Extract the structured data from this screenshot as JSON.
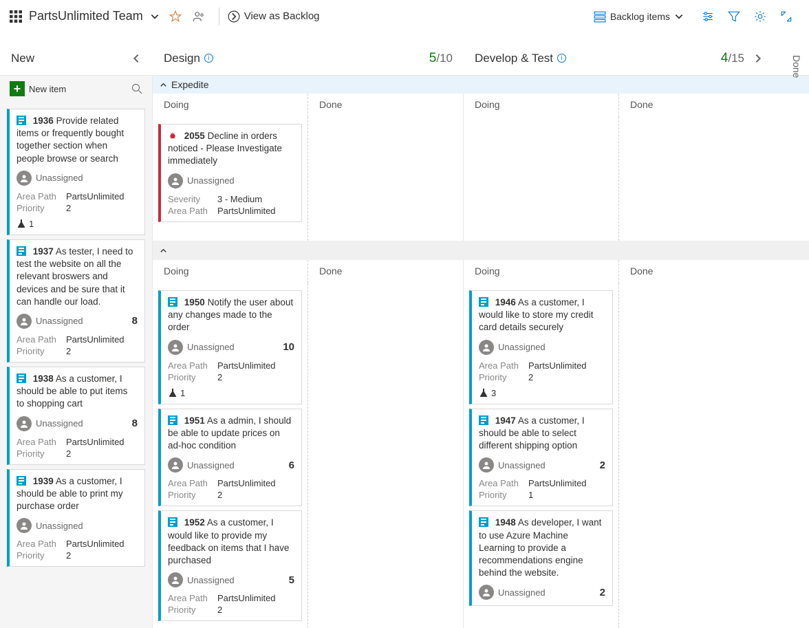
{
  "header": {
    "teamName": "PartsUnlimited Team",
    "viewBacklog": "View as Backlog",
    "backlogItems": "Backlog items"
  },
  "columns": {
    "new": "New",
    "design": "Design",
    "designWip": {
      "cur": "5",
      "lim": "/10"
    },
    "dev": "Develop & Test",
    "devWip": {
      "cur": "4",
      "lim": "/15"
    },
    "done": "Done"
  },
  "newItem": "New item",
  "expedite": "Expedite",
  "subcols": {
    "doing": "Doing",
    "done": "Done"
  },
  "labels": {
    "areaPath": "Area Path",
    "priority": "Priority",
    "severity": "Severity",
    "unassigned": "Unassigned"
  },
  "bug": {
    "id": "2055",
    "title": "Decline in orders noticed - Please Investigate immediately",
    "severity": "3 - Medium",
    "areaPath": "PartsUnlimited"
  },
  "newCol": [
    {
      "id": "1936",
      "title": "Provide related items or frequently bought together section when people browse or search",
      "areaPath": "PartsUnlimited",
      "priority": "2",
      "flask": "1"
    },
    {
      "id": "1937",
      "title": "As tester, I need to test the website on all the relevant broswers and devices and be sure that it can handle our load.",
      "areaPath": "PartsUnlimited",
      "priority": "2",
      "pts": "8"
    },
    {
      "id": "1938",
      "title": "As a customer, I should be able to put items to shopping cart",
      "areaPath": "PartsUnlimited",
      "priority": "2",
      "pts": "8"
    },
    {
      "id": "1939",
      "title": "As a customer, I should be able to print my purchase order",
      "areaPath": "PartsUnlimited",
      "priority": "2"
    }
  ],
  "designDoing": [
    {
      "id": "1950",
      "title": "Notify the user about any changes made to the order",
      "areaPath": "PartsUnlimited",
      "priority": "2",
      "pts": "10",
      "flask": "1"
    },
    {
      "id": "1951",
      "title": "As a admin, I should be able to update prices on ad-hoc condition",
      "areaPath": "PartsUnlimited",
      "priority": "2",
      "pts": "6"
    },
    {
      "id": "1952",
      "title": "As a customer, I would like to provide my feedback on items that I have purchased",
      "areaPath": "PartsUnlimited",
      "priority": "2",
      "pts": "5"
    }
  ],
  "devDoing": [
    {
      "id": "1946",
      "title": "As a customer, I would like to store my credit card details securely",
      "areaPath": "PartsUnlimited",
      "priority": "2",
      "flask": "3"
    },
    {
      "id": "1947",
      "title": "As a customer, I should be able to select different shipping option",
      "areaPath": "PartsUnlimited",
      "priority": "1",
      "pts": "2"
    },
    {
      "id": "1948",
      "title": "As developer, I want to use Azure Machine Learning to provide a recommendations engine behind the website.",
      "pts": "2"
    }
  ]
}
